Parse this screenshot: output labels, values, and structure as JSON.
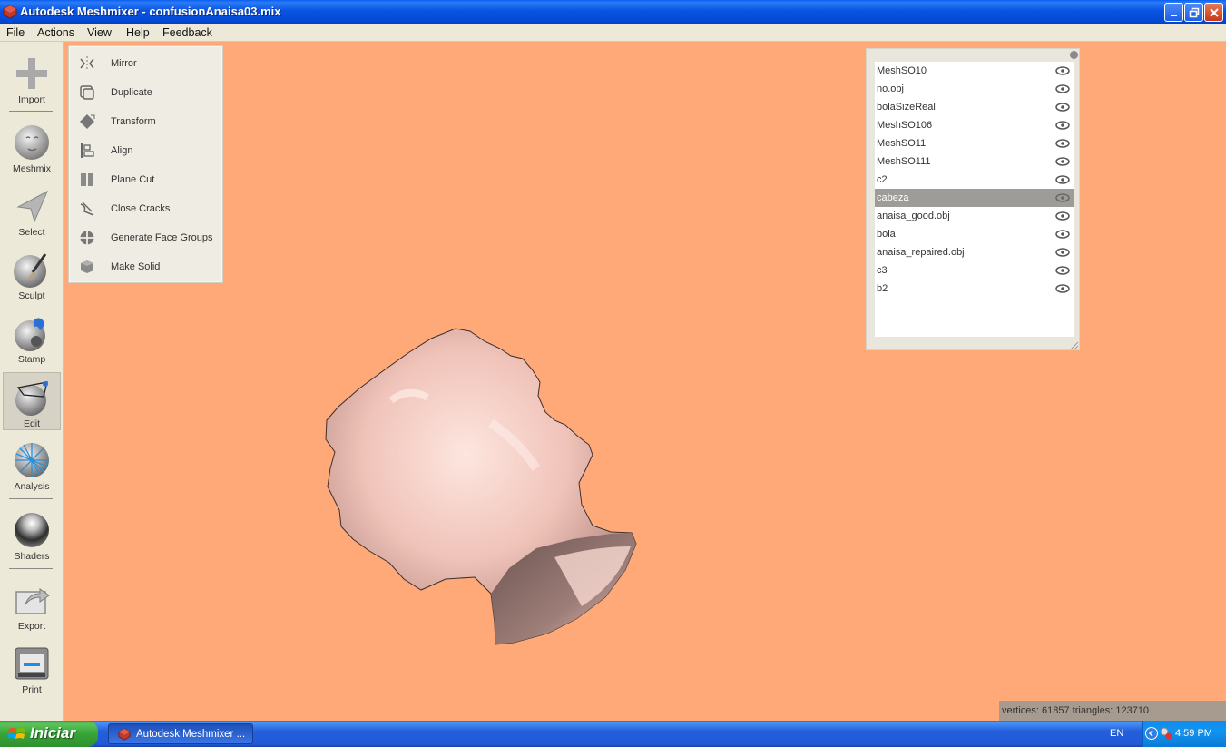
{
  "window": {
    "title": "Autodesk Meshmixer - confusionAnaisa03.mix",
    "colors": {
      "viewport_bg": "#ffa978",
      "mesh": "#f6cdc4",
      "menu_bg": "#ece9d8"
    }
  },
  "menubar": {
    "items": [
      "File",
      "Actions",
      "View",
      "Help",
      "Feedback"
    ]
  },
  "toolbar": {
    "tools": [
      {
        "label": "Import",
        "icon": "plus-icon"
      },
      {
        "label": "Meshmix",
        "icon": "meshmix-face-icon"
      },
      {
        "label": "Select",
        "icon": "select-arrow-icon"
      },
      {
        "label": "Sculpt",
        "icon": "sculpt-brush-icon"
      },
      {
        "label": "Stamp",
        "icon": "stamp-icon"
      },
      {
        "label": "Edit",
        "icon": "edit-sphere-icon",
        "active": true
      },
      {
        "label": "Analysis",
        "icon": "analysis-mesh-icon"
      },
      {
        "label": "Shaders",
        "icon": "shaders-sphere-icon"
      },
      {
        "label": "Export",
        "icon": "export-icon"
      },
      {
        "label": "Print",
        "icon": "printer-icon"
      }
    ]
  },
  "edit_menu": {
    "items": [
      {
        "label": "Mirror",
        "icon": "mirror-icon"
      },
      {
        "label": "Duplicate",
        "icon": "duplicate-icon"
      },
      {
        "label": "Transform",
        "icon": "transform-icon"
      },
      {
        "label": "Align",
        "icon": "align-icon"
      },
      {
        "label": "Plane Cut",
        "icon": "plane-cut-icon"
      },
      {
        "label": "Close Cracks",
        "icon": "close-cracks-icon"
      },
      {
        "label": "Generate Face Groups",
        "icon": "face-groups-icon"
      },
      {
        "label": "Make Solid",
        "icon": "make-solid-icon"
      }
    ]
  },
  "object_browser": {
    "selected_index": 7,
    "objects": [
      "MeshSO10",
      "no.obj",
      "bolaSizeReal",
      "MeshSO106",
      "MeshSO11",
      "MeshSO111",
      "c2",
      "cabeza",
      "anaisa_good.obj",
      "bola",
      "anaisa_repaired.obj",
      "c3",
      "b2"
    ]
  },
  "status": {
    "text": "vertices: 61857  triangles: 123710"
  },
  "taskbar": {
    "start_label": "Iniciar",
    "task_label": "Autodesk Meshmixer ...",
    "language": "EN",
    "clock": "4:59 PM"
  }
}
